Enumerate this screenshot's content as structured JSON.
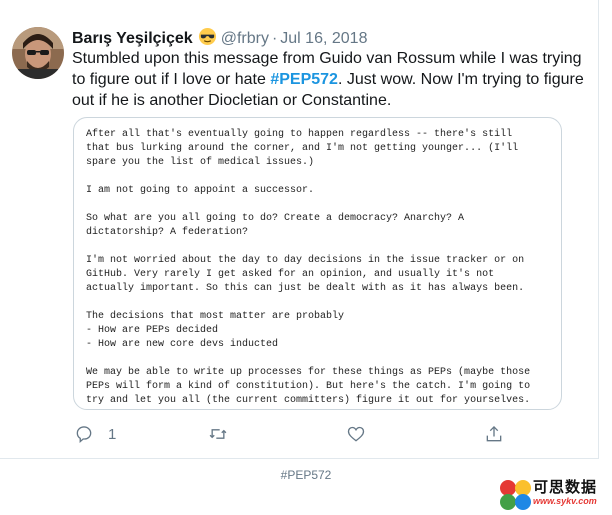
{
  "tweet": {
    "author_name": "Barış Yeşilçiçek",
    "author_handle": "@frbry",
    "separator": "·",
    "date": "Jul 16, 2018",
    "emoji_name": "sunglasses-emoji",
    "text_before": "Stumbled upon this message from Guido van Rossum while I was trying to figure out if I love or hate ",
    "hashtag": "#PEP572",
    "text_after": ". Just wow. Now I'm trying to figure out if he is another Diocletian or Constantine.",
    "media_text": "After all that's eventually going to happen regardless -- there's still\nthat bus lurking around the corner, and I'm not getting younger... (I'll\nspare you the list of medical issues.)\n\nI am not going to appoint a successor.\n\nSo what are you all going to do? Create a democracy? Anarchy? A\ndictatorship? A federation?\n\nI'm not worried about the day to day decisions in the issue tracker or on\nGitHub. Very rarely I get asked for an opinion, and usually it's not\nactually important. So this can just be dealt with as it has always been.\n\nThe decisions that most matter are probably\n- How are PEPs decided\n- How are new core devs inducted\n\nWe may be able to write up processes for these things as PEPs (maybe those\nPEPs will form a kind of constitution). But here's the catch. I'm going to\ntry and let you all (the current committers) figure it out for yourselves."
  },
  "actions": {
    "reply_icon": "reply-icon",
    "reply_count": "1",
    "retweet_icon": "retweet-icon",
    "like_icon": "heart-icon",
    "share_icon": "share-icon"
  },
  "footer": {
    "hashtag": "#PEP572"
  },
  "watermark": {
    "text": "可思数据",
    "url": "www.sykv.com"
  },
  "colors": {
    "link": "#1b95e0",
    "secondary": "#657786",
    "border": "#ccd6dd"
  }
}
